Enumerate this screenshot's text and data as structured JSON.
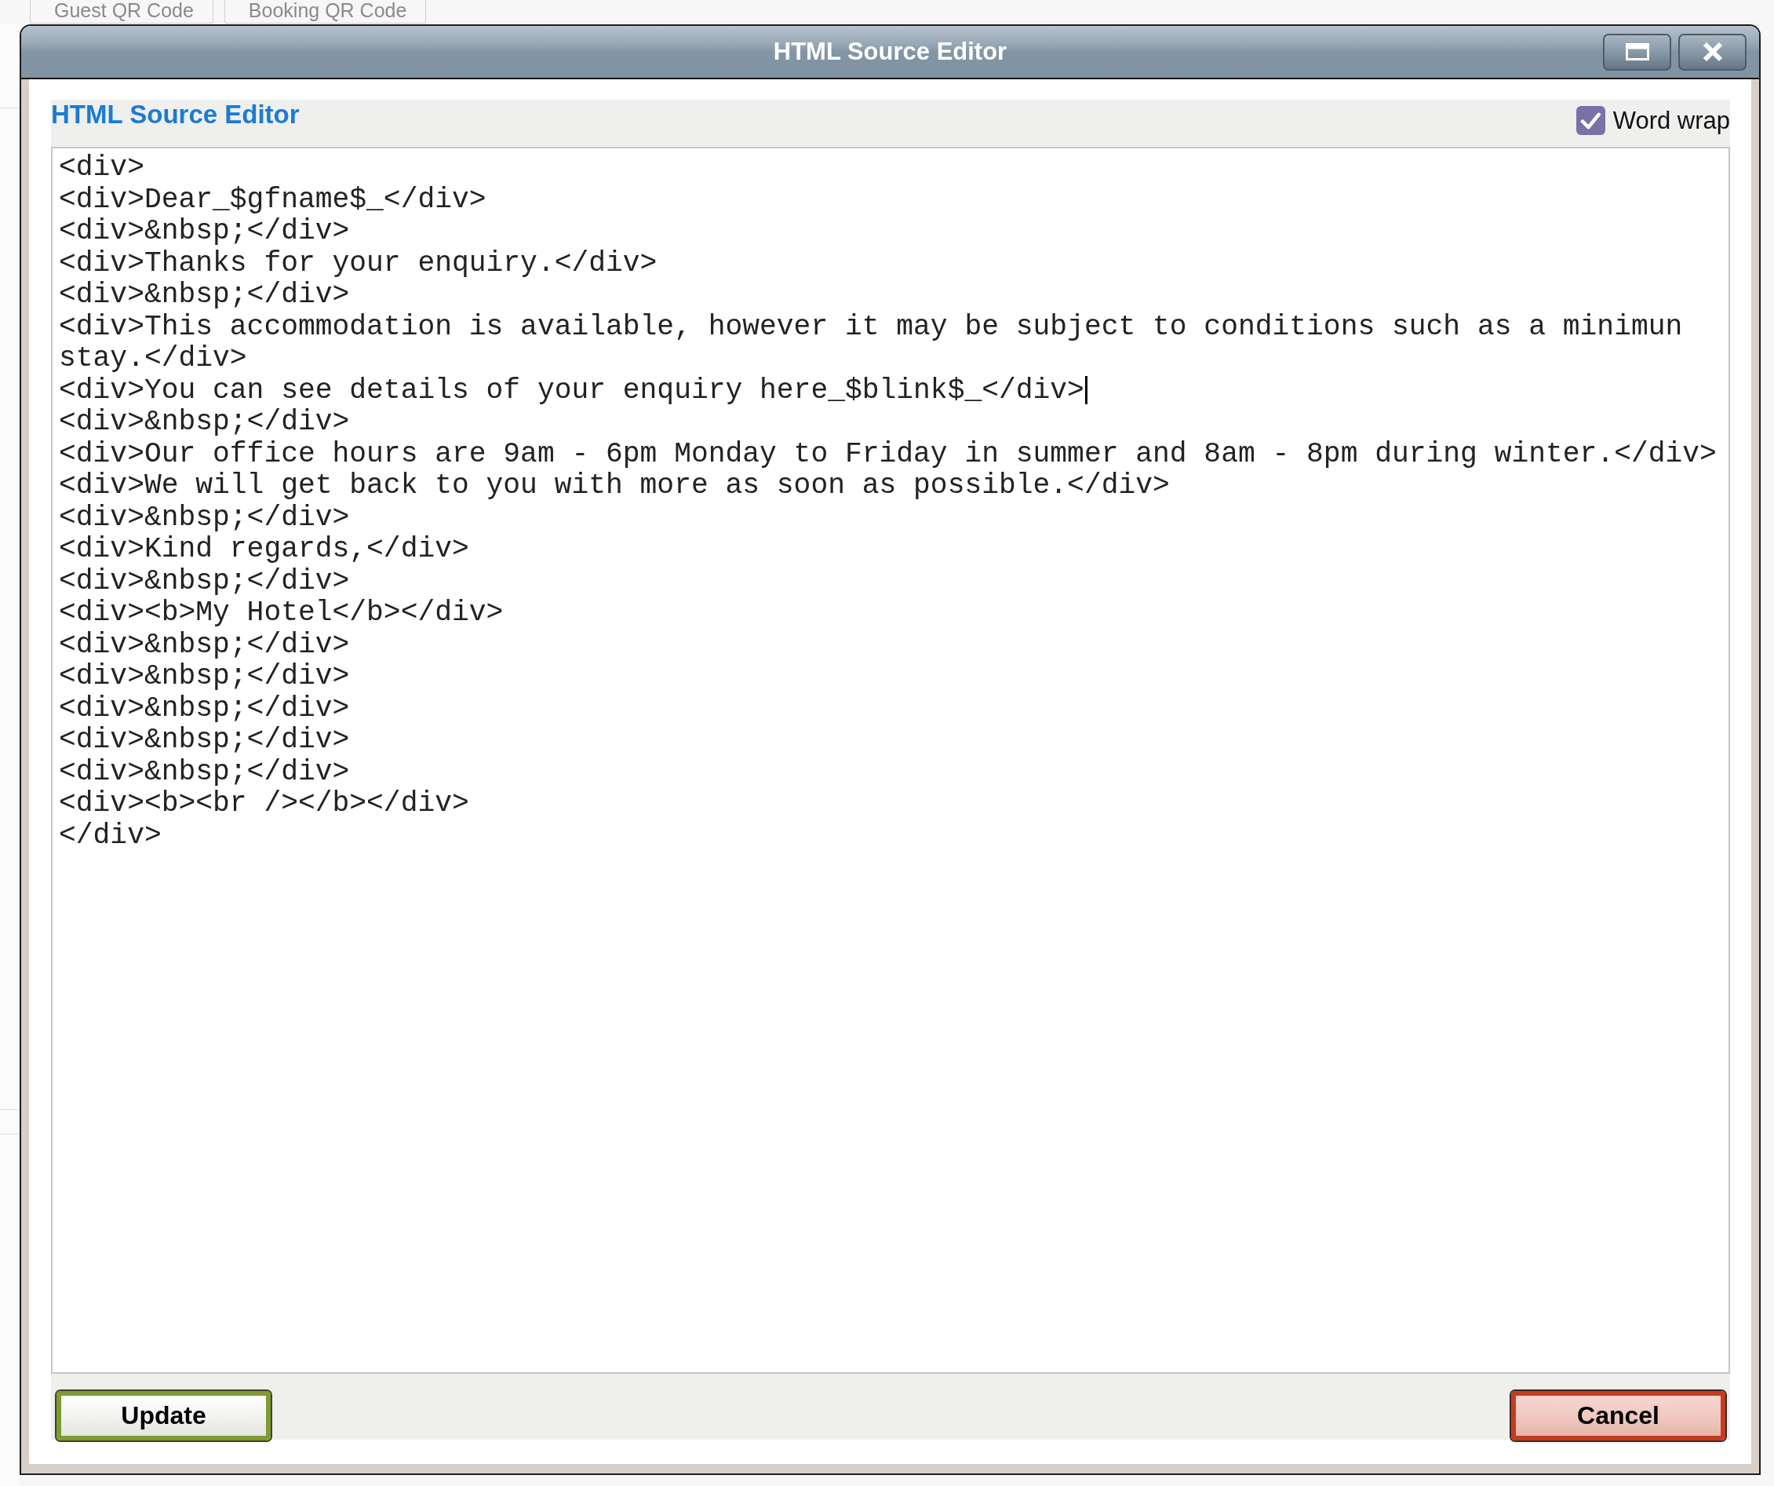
{
  "background_tabs": [
    {
      "label": "Guest QR Code"
    },
    {
      "label": "Booking QR Code"
    }
  ],
  "dialog": {
    "title": "HTML Source Editor",
    "heading": "HTML Source Editor",
    "word_wrap": {
      "label": "Word wrap",
      "checked": true
    },
    "source_lines": [
      {
        "text": "<div>",
        "caret": false
      },
      {
        "text": "<div>Dear_$gfname$_</div>",
        "caret": false
      },
      {
        "text": "<div>&nbsp;</div>",
        "caret": false
      },
      {
        "text": "<div>Thanks for your enquiry.</div>",
        "caret": false
      },
      {
        "text": "<div>&nbsp;</div>",
        "caret": false
      },
      {
        "text": "<div>This accommodation is available, however it may be subject to conditions such as a minimun stay.</div>",
        "caret": false
      },
      {
        "text": "<div>You can see details of your enquiry here_$blink$_</div>",
        "caret": true
      },
      {
        "text": "<div>&nbsp;</div>",
        "caret": false
      },
      {
        "text": "<div>Our office hours are 9am - 6pm Monday to Friday in summer and 8am - 8pm during winter.</div>",
        "caret": false
      },
      {
        "text": "<div>We will get back to you with more as soon as possible.</div>",
        "caret": false
      },
      {
        "text": "<div>&nbsp;</div>",
        "caret": false
      },
      {
        "text": "<div>Kind regards,</div>",
        "caret": false
      },
      {
        "text": "<div>&nbsp;</div>",
        "caret": false
      },
      {
        "text": "<div><b>My Hotel</b></div>",
        "caret": false
      },
      {
        "text": "<div>&nbsp;</div>",
        "caret": false
      },
      {
        "text": "<div>&nbsp;</div>",
        "caret": false
      },
      {
        "text": "<div>&nbsp;</div>",
        "caret": false
      },
      {
        "text": "<div>&nbsp;</div>",
        "caret": false
      },
      {
        "text": "<div>&nbsp;</div>",
        "caret": false
      },
      {
        "text": "<div><b><br /></b></div>",
        "caret": false
      },
      {
        "text": "</div>",
        "caret": false
      }
    ],
    "buttons": [
      {
        "label": "Update",
        "kind": "confirm"
      },
      {
        "label": "Cancel",
        "kind": "cancel"
      }
    ]
  }
}
